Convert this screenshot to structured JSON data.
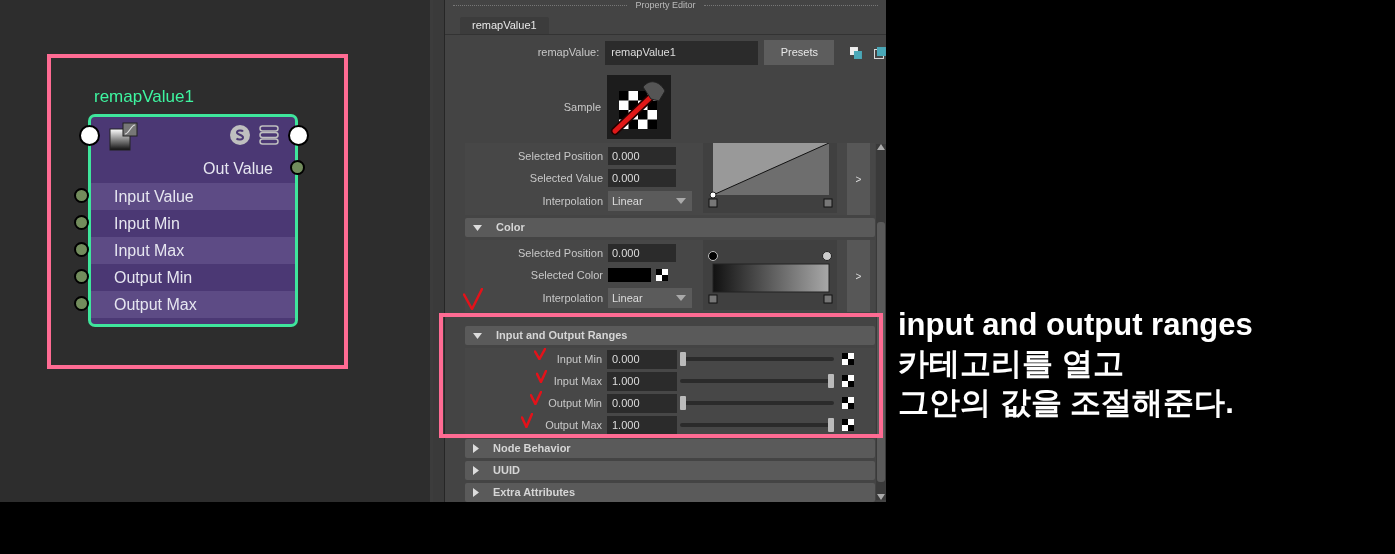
{
  "node_editor": {
    "node": {
      "title": "remapValue1",
      "output": "Out Value",
      "inputs": [
        "Input Value",
        "Input Min",
        "Input Max",
        "Output Min",
        "Output Max"
      ]
    }
  },
  "property_editor": {
    "title": "Property Editor",
    "tabs": [
      {
        "label": "remapValue1",
        "selected": true
      }
    ],
    "type_label": "remapValue:",
    "node_name": "remapValue1",
    "presets_button": "Presets",
    "sample_label": "Sample",
    "sections": [
      {
        "kind": "ramp",
        "fields": [
          {
            "label": "Selected Position",
            "value": "0.000"
          },
          {
            "label": "Selected Value",
            "value": "0.000"
          }
        ],
        "interpolation_label": "Interpolation",
        "interpolation": "Linear",
        "expand_button": ">"
      },
      {
        "kind": "color_ramp",
        "title": "Color",
        "expanded": true,
        "fields": [
          {
            "label": "Selected Position",
            "value": "0.000"
          }
        ],
        "color_label": "Selected Color",
        "color": "#000000",
        "interpolation_label": "Interpolation",
        "interpolation": "Linear",
        "expand_button": ">"
      },
      {
        "kind": "sliders",
        "title": "Input and Output Ranges",
        "expanded": true,
        "rows": [
          {
            "label": "Input Min",
            "value": "0.000",
            "level": 0
          },
          {
            "label": "Input Max",
            "value": "1.000",
            "level": 1
          },
          {
            "label": "Output Min",
            "value": "0.000",
            "level": 0
          },
          {
            "label": "Output Max",
            "value": "1.000",
            "level": 1
          }
        ]
      },
      {
        "kind": "collapsed",
        "title": "Node Behavior",
        "expanded": false
      },
      {
        "kind": "collapsed",
        "title": "UUID",
        "expanded": false
      },
      {
        "kind": "collapsed",
        "title": "Extra Attributes",
        "expanded": false
      }
    ]
  },
  "annotation": {
    "lines": [
      "input and output ranges",
      "카테고리를 열고",
      "그안의 값을 조절해준다."
    ]
  }
}
